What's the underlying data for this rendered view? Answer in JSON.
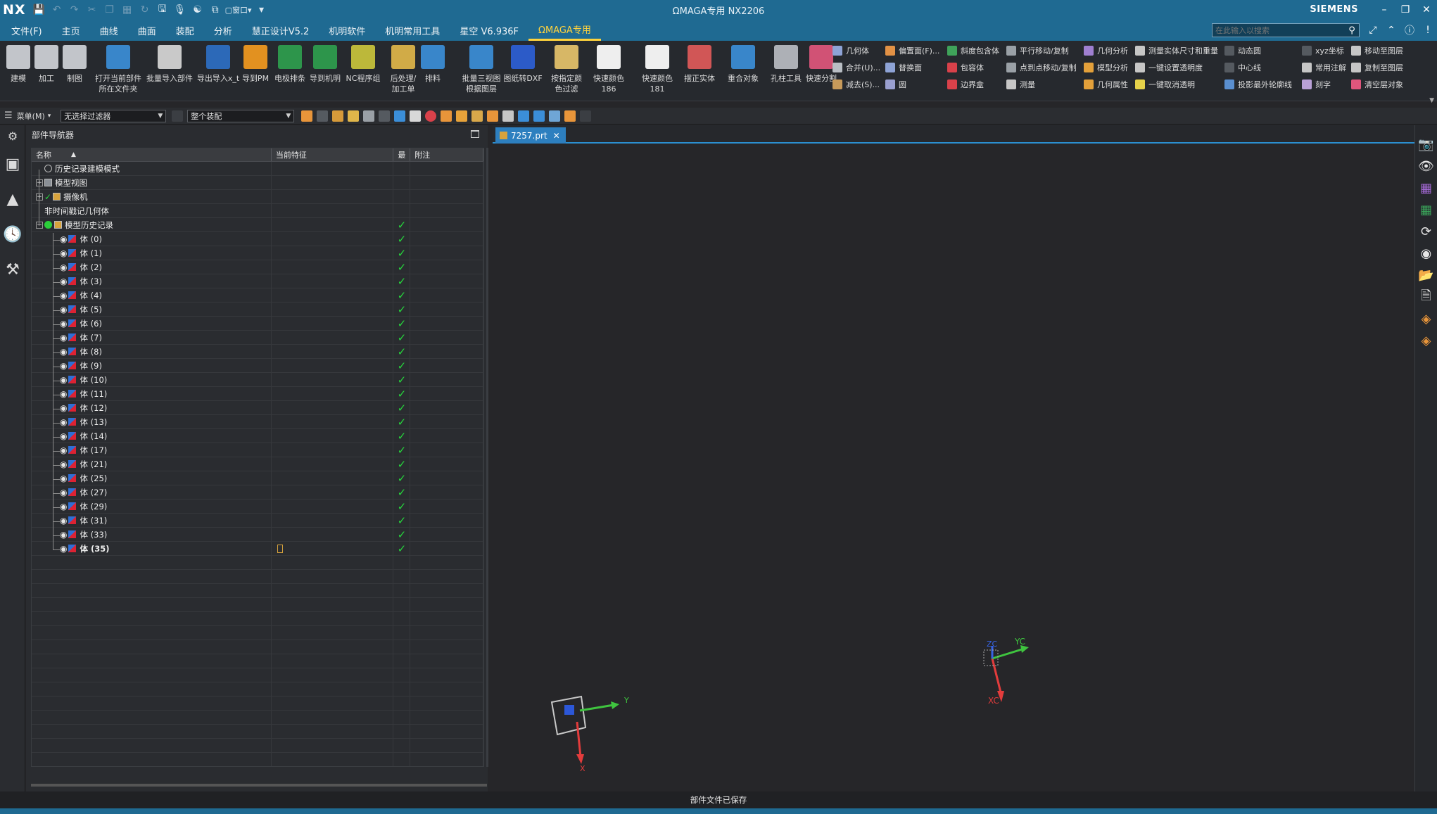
{
  "window": {
    "app_logo": "NX",
    "title": "ΩMAGA专用 NX2206",
    "brand": "SIEMENS",
    "window_menu_label": "窗口",
    "controls": [
      "minimize",
      "restore",
      "close"
    ]
  },
  "menu_tabs": [
    {
      "label": "文件(F)"
    },
    {
      "label": "主页"
    },
    {
      "label": "曲线"
    },
    {
      "label": "曲面"
    },
    {
      "label": "装配"
    },
    {
      "label": "分析"
    },
    {
      "label": "慧正设计V5.2"
    },
    {
      "label": "机明软件"
    },
    {
      "label": "机明常用工具"
    },
    {
      "label": "星空 V6.936F"
    },
    {
      "label": "ΩMAGA专用"
    }
  ],
  "search": {
    "placeholder": "在此输入以搜索"
  },
  "ribbon": {
    "big_buttons": [
      {
        "label": "建模",
        "icon": "modeling-icon",
        "color": "#cfd3d8"
      },
      {
        "label": "加工",
        "icon": "manufacturing-icon",
        "color": "#cfd3d8"
      },
      {
        "label": "制图",
        "icon": "drafting-icon",
        "color": "#cfd3d8"
      },
      {
        "label": "打开当前部件\n所在文件夹",
        "icon": "open-folder-icon",
        "color": "#3b8ed8"
      },
      {
        "label": "批量导入部件",
        "icon": "batch-import-icon",
        "color": "#d7d7d7"
      },
      {
        "label": "导出导入x_t",
        "icon": "export-import-icon",
        "color": "#2d6fc4"
      },
      {
        "label": "导到PM",
        "icon": "export-pm-icon",
        "color": "#f29a1f"
      },
      {
        "label": "电极排条",
        "icon": "electrode-list-icon",
        "color": "#2e9e4e"
      },
      {
        "label": "导到机明",
        "icon": "export-jiming-icon",
        "color": "#2e9e4e"
      },
      {
        "label": "NC程序组",
        "icon": "nc-program-icon",
        "color": "#c9c43c"
      },
      {
        "label": "后处理/\n加工单",
        "icon": "postprocess-icon",
        "color": "#e0b64a"
      },
      {
        "label": "排料",
        "icon": "nesting-icon",
        "color": "#3b8ed8"
      },
      {
        "label": "批量三视图\n根据图层",
        "icon": "three-view-icon",
        "color": "#3b8ed8"
      },
      {
        "label": "图纸转DXF",
        "icon": "dxf-icon",
        "color": "#2c5fd6"
      },
      {
        "label": "按指定颜\n色过滤",
        "icon": "color-filter-icon",
        "color": "#e6c36b"
      },
      {
        "label": "快速颜色186",
        "icon": "color-186-icon",
        "color": "#ffffff"
      },
      {
        "label": "快速颜色181",
        "icon": "color-181-icon",
        "color": "#ffffff"
      },
      {
        "label": "摆正实体",
        "icon": "align-body-icon",
        "color": "#e05a5a"
      },
      {
        "label": "重合对象",
        "icon": "coincident-icon",
        "color": "#3b8ed8"
      },
      {
        "label": "孔柱工具",
        "icon": "hole-tool-icon",
        "color": "#b8bcc2"
      },
      {
        "label": "快速分割",
        "icon": "quick-split-icon",
        "color": "#e0567c"
      }
    ],
    "small_columns": [
      [
        {
          "label": "几何体",
          "icon": "geometry-icon",
          "color": "#8ea3d6"
        },
        {
          "label": "合并(U)...",
          "icon": "unite-icon",
          "color": "#b9bec4"
        },
        {
          "label": "减去(S)...",
          "icon": "subtract-icon",
          "color": "#c79a5a"
        }
      ],
      [
        {
          "label": "偏置面(F)...",
          "icon": "offset-face-icon",
          "color": "#e29145"
        },
        {
          "label": "替换面",
          "icon": "replace-face-icon",
          "color": "#8ea3d6"
        },
        {
          "label": "圆",
          "icon": "circle-icon",
          "color": "#9aa0d0"
        }
      ],
      [
        {
          "label": "斜度包含体",
          "icon": "draft-body-icon",
          "color": "#3fa35a"
        },
        {
          "label": "包容体",
          "icon": "bounding-body-icon",
          "color": "#d9414a"
        },
        {
          "label": "边界盒",
          "icon": "boundary-box-icon",
          "color": "#d9414a"
        }
      ],
      [
        {
          "label": "平行移动/复制",
          "icon": "parallel-move-icon",
          "color": "#9aa0a6"
        },
        {
          "label": "点到点移动/复制",
          "icon": "point-move-icon",
          "color": "#9aa0a6"
        },
        {
          "label": "测量",
          "icon": "measure-icon",
          "color": "#c6c6c6"
        }
      ],
      [
        {
          "label": "几何分析",
          "icon": "geometry-analysis-icon",
          "color": "#9f7fd0"
        },
        {
          "label": "模型分析",
          "icon": "model-analysis-icon",
          "color": "#e3a03a"
        },
        {
          "label": "几何属性",
          "icon": "geometry-props-icon",
          "color": "#e3a03a"
        }
      ],
      [
        {
          "label": "测量实体尺寸和重量",
          "icon": "measure-weight-icon",
          "color": "#c6c6c6"
        },
        {
          "label": "一键设置透明度",
          "icon": "set-transparency-icon",
          "color": "#c6c6c6"
        },
        {
          "label": "一键取消透明",
          "icon": "cancel-transparency-icon",
          "color": "#e6d24a"
        }
      ],
      [
        {
          "label": "动态圆",
          "icon": "dynamic-circle-icon",
          "color": "#555a60"
        },
        {
          "label": "中心线",
          "icon": "centerline-icon",
          "color": "#555a60"
        },
        {
          "label": "投影最外轮廓线",
          "icon": "projection-outline-icon",
          "color": "#5a8fd0"
        }
      ],
      [
        {
          "label": "xyz坐标",
          "icon": "xyz-coord-icon",
          "color": "#555a60"
        },
        {
          "label": "常用注解",
          "icon": "annotation-icon",
          "color": "#c6c6c6"
        },
        {
          "label": "刻字",
          "icon": "engrave-icon",
          "color": "#b9a0d6"
        }
      ],
      [
        {
          "label": "移动至图层",
          "icon": "move-layer-icon",
          "color": "#c6c6c6"
        },
        {
          "label": "复制至图层",
          "icon": "copy-layer-icon",
          "color": "#c6c6c6"
        },
        {
          "label": "清空层对象",
          "icon": "clear-layer-icon",
          "color": "#e0567c"
        }
      ]
    ]
  },
  "selection_bar": {
    "menu_label": "菜单(M)",
    "type_filter": "无选择过滤器",
    "scope": "整个装配"
  },
  "part_navigator": {
    "title": "部件导航器",
    "columns": {
      "name": "名称",
      "current_feature": "当前特征",
      "latest": "最",
      "comment": "附注"
    },
    "sections": [
      {
        "label": "历史记录建模模式",
        "icon": "history-mode-icon",
        "expander": ""
      },
      {
        "label": "模型视图",
        "icon": "model-views-icon",
        "expander": "+"
      },
      {
        "label": "摄像机",
        "icon": "camera-icon",
        "expander": "+"
      },
      {
        "label": "非时间戳记几何体",
        "icon": "",
        "expander": ""
      },
      {
        "label": "模型历史记录",
        "icon": "model-history-icon",
        "expander": "−"
      }
    ],
    "bodies": [
      "体 (0)",
      "体 (1)",
      "体 (2)",
      "体 (3)",
      "体 (4)",
      "体 (5)",
      "体 (6)",
      "体 (7)",
      "体 (8)",
      "体 (9)",
      "体 (10)",
      "体 (11)",
      "体 (12)",
      "体 (13)",
      "体 (14)",
      "体 (17)",
      "体 (21)",
      "体 (25)",
      "体 (27)",
      "体 (29)",
      "体 (31)",
      "体 (33)",
      "体 (35)"
    ],
    "current_body": "体 (35)"
  },
  "graphics": {
    "file_tab": "7257.prt",
    "triad": {
      "x": "X",
      "y": "Y"
    },
    "wcs": {
      "xc": "XC",
      "yc": "YC",
      "zc": "ZC"
    }
  },
  "status_bar": {
    "message": "部件文件已保存"
  },
  "colors": {
    "title_bar": "#1f6a92",
    "active_tab": "#ffd33d",
    "check": "#26d63c",
    "viewport_bg": "#262629",
    "accent": "#2d7fbf"
  }
}
